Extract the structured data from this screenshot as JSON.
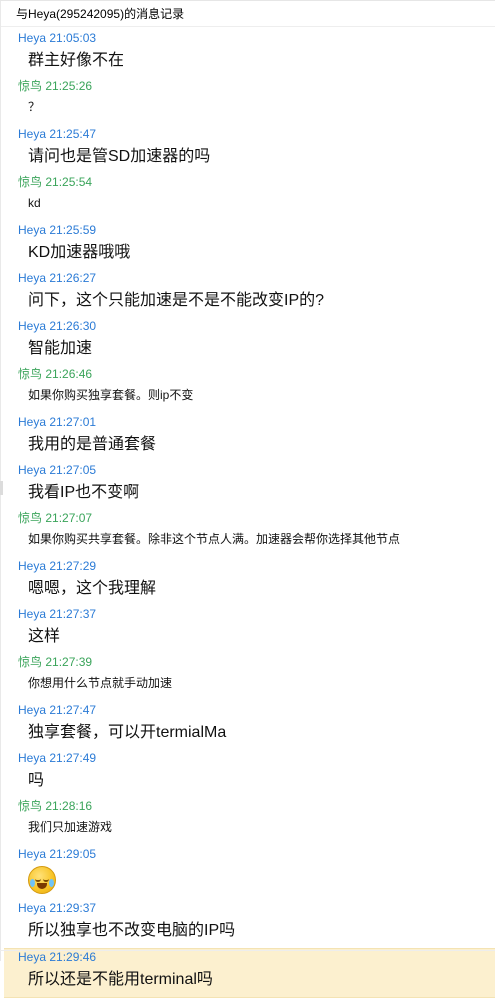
{
  "title": "与Heya(295242095)的消息记录",
  "messages": [
    {
      "sender": "Heya",
      "time": "21:05:03",
      "text": "群主好像不在",
      "size": "large"
    },
    {
      "sender": "惊鸟",
      "time": "21:25:26",
      "text": "？",
      "size": "small"
    },
    {
      "sender": "Heya",
      "time": "21:25:47",
      "text": "请问也是管SD加速器的吗",
      "size": "large"
    },
    {
      "sender": "惊鸟",
      "time": "21:25:54",
      "text": "kd",
      "size": "small"
    },
    {
      "sender": "Heya",
      "time": "21:25:59",
      "text": "KD加速器哦哦",
      "size": "large"
    },
    {
      "sender": "Heya",
      "time": "21:26:27",
      "text": "问下，这个只能加速是不是不能改变IP的?",
      "size": "large"
    },
    {
      "sender": "Heya",
      "time": "21:26:30",
      "text": "智能加速",
      "size": "large"
    },
    {
      "sender": "惊鸟",
      "time": "21:26:46",
      "text": "如果你购买独享套餐。则ip不变",
      "size": "small"
    },
    {
      "sender": "Heya",
      "time": "21:27:01",
      "text": "我用的是普通套餐",
      "size": "large"
    },
    {
      "sender": "Heya",
      "time": "21:27:05",
      "text": "我看IP也不变啊",
      "size": "large"
    },
    {
      "sender": "惊鸟",
      "time": "21:27:07",
      "text": "如果你购买共享套餐。除非这个节点人满。加速器会帮你选择其他节点",
      "size": "small"
    },
    {
      "sender": "Heya",
      "time": "21:27:29",
      "text": "嗯嗯，这个我理解",
      "size": "large"
    },
    {
      "sender": "Heya",
      "time": "21:27:37",
      "text": "这样",
      "size": "large"
    },
    {
      "sender": "惊鸟",
      "time": "21:27:39",
      "text": "你想用什么节点就手动加速",
      "size": "small"
    },
    {
      "sender": "Heya",
      "time": "21:27:47",
      "text": "独享套餐，可以开termialMa",
      "size": "large"
    },
    {
      "sender": "Heya",
      "time": "21:27:49",
      "text": "吗",
      "size": "large"
    },
    {
      "sender": "惊鸟",
      "time": "21:28:16",
      "text": "我们只加速游戏",
      "size": "small"
    },
    {
      "sender": "Heya",
      "time": "21:29:05",
      "text": "",
      "size": "emoji",
      "icon": "crying-laughing-emoji-icon"
    },
    {
      "sender": "Heya",
      "time": "21:29:37",
      "text": "所以独享也不改变电脑的IP吗",
      "size": "large"
    },
    {
      "sender": "Heya",
      "time": "21:29:46",
      "text": "所以还是不能用terminal吗",
      "size": "large",
      "highlight": true
    }
  ],
  "colors": {
    "heya": "#2b7bd6",
    "jingniao": "#3aa45a",
    "highlight": "#fcf0cf"
  }
}
